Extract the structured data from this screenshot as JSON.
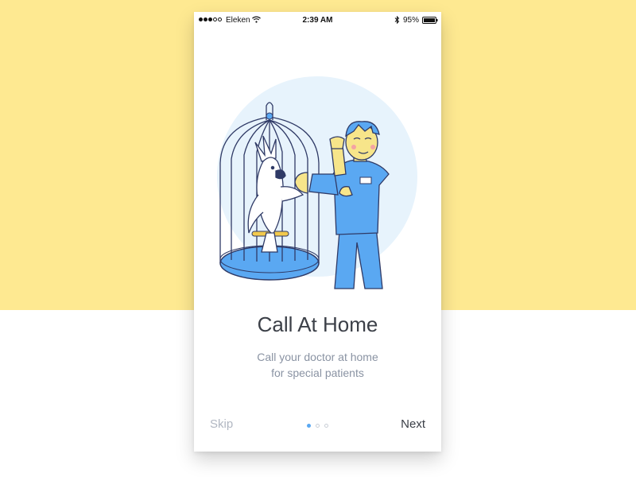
{
  "status_bar": {
    "carrier": "Eleken",
    "time": "2:39 AM",
    "battery_percent": "95%"
  },
  "onboarding": {
    "title": "Call At Home",
    "subtitle_line1": "Call your doctor at home",
    "subtitle_line2": "for special patients",
    "illustration": "doctor-with-parrot-in-cage"
  },
  "navigation": {
    "skip_label": "Skip",
    "next_label": "Next",
    "page_count": 3,
    "active_page": 1
  },
  "colors": {
    "background_top": "#FEE991",
    "background_bottom": "#FFFFFF",
    "accent": "#5AA8F2",
    "title": "#3C4048",
    "subtitle": "#8A93A3"
  }
}
